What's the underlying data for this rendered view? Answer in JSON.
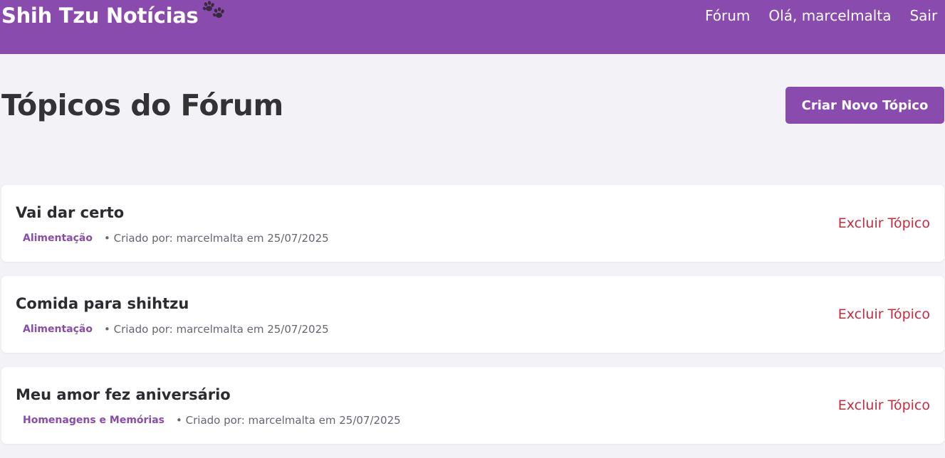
{
  "header": {
    "brand": "Shih Tzu Notícias",
    "nav": {
      "forum": "Fórum",
      "greeting": "Olá, marcelmalta",
      "logout": "Sair"
    }
  },
  "main": {
    "title": "Tópicos do Fórum",
    "new_topic_label": "Criar Novo Tópico"
  },
  "topics": [
    {
      "title": "Vai dar certo",
      "category": "Alimentação",
      "meta": "• Criado por: marcelmalta em 25/07/2025",
      "delete_label": "Excluir Tópico"
    },
    {
      "title": "Comida para shihtzu",
      "category": "Alimentação",
      "meta": "• Criado por: marcelmalta em 25/07/2025",
      "delete_label": "Excluir Tópico"
    },
    {
      "title": "Meu amor fez aniversário",
      "category": "Homenagens e Memórias",
      "meta": "• Criado por: marcelmalta em 25/07/2025",
      "delete_label": "Excluir Tópico"
    }
  ],
  "colors": {
    "brand": "#8a4bae",
    "background": "#f3f2f7",
    "danger": "#c92a3e"
  },
  "icons": {
    "brand_icon": "paw-prints-icon"
  }
}
